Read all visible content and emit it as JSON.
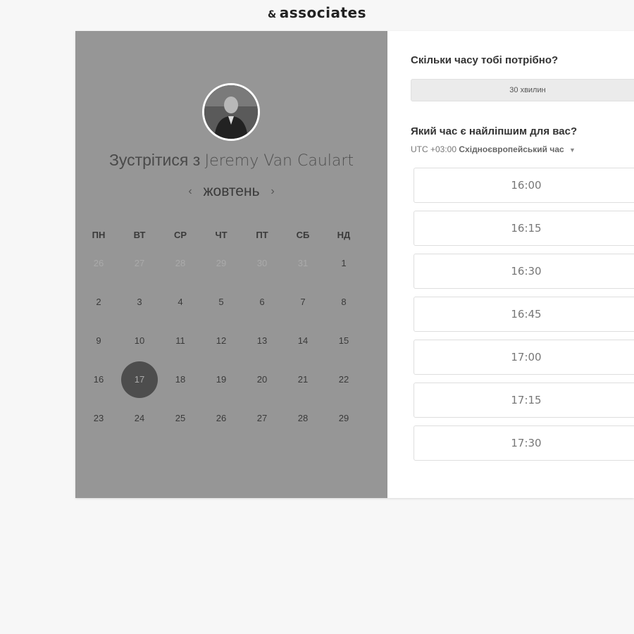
{
  "header": {
    "brand_amp": "&",
    "brand_text": "associates"
  },
  "profile": {
    "meet_prefix": "Зустрітися з",
    "name": "Jeremy Van Caulart"
  },
  "calendar": {
    "prev_arrow": "‹",
    "month": "жовтень",
    "next_arrow": "›",
    "weekdays": [
      "ПН",
      "ВТ",
      "СР",
      "ЧТ",
      "ПТ",
      "СБ",
      "НД"
    ],
    "weeks": [
      [
        "26",
        "27",
        "28",
        "29",
        "30",
        "31",
        "1"
      ],
      [
        "2",
        "3",
        "4",
        "5",
        "6",
        "7",
        "8"
      ],
      [
        "9",
        "10",
        "11",
        "12",
        "13",
        "14",
        "15"
      ],
      [
        "16",
        "17",
        "18",
        "19",
        "20",
        "21",
        "22"
      ],
      [
        "23",
        "24",
        "25",
        "26",
        "27",
        "28",
        "29"
      ]
    ],
    "selected_day": "17"
  },
  "booking": {
    "duration_question": "Скільки часу тобі потрібно?",
    "duration_value": "30 хвилин",
    "time_question": "Який час є найліпшим для вас?",
    "tz_offset": "UTC +03:00",
    "tz_name": "Східноєвропейський час",
    "tz_caret": "▼",
    "slots": [
      "16:00",
      "16:15",
      "16:30",
      "16:45",
      "17:00",
      "17:15",
      "17:30"
    ]
  },
  "colors": {
    "left_panel": "#969696",
    "selected_day_bg": "#4d4d4d",
    "page_bg": "#f7f7f7"
  }
}
